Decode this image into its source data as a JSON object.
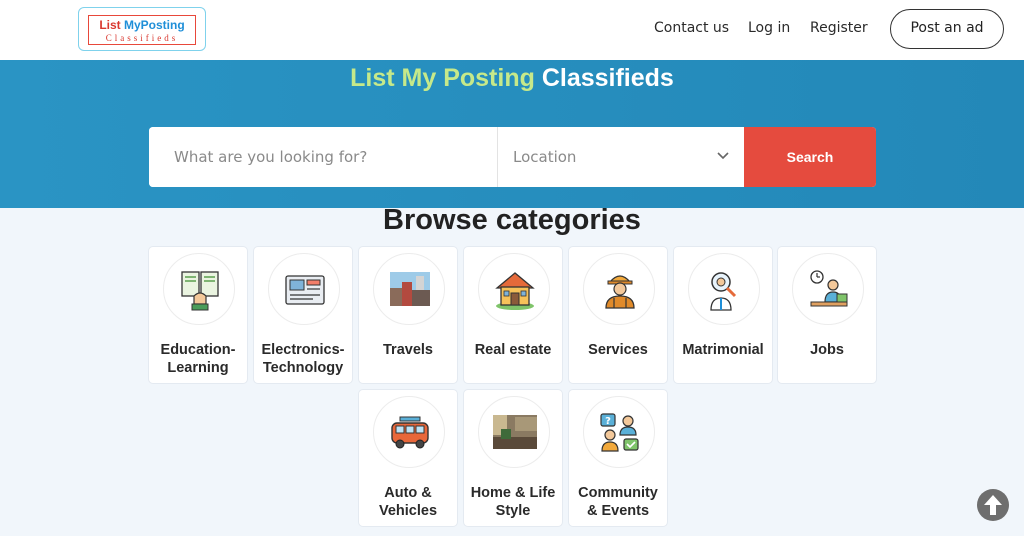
{
  "header": {
    "logo_line1_a": "List ",
    "logo_line1_b": "MyPosting",
    "logo_line2": "Classifieds",
    "nav": {
      "contact": "Contact us",
      "login": "Log in",
      "register": "Register"
    },
    "post_ad": "Post an ad"
  },
  "hero": {
    "title_a": "List My Posting",
    "title_b": "Classifieds",
    "search_placeholder": "What are you looking for?",
    "location_placeholder": "Location",
    "search_button": "Search"
  },
  "browse": {
    "title": "Browse categories",
    "categories": [
      {
        "label": "Education-\nLearning",
        "icon": "education-icon"
      },
      {
        "label": "Electronics-\nTechnology",
        "icon": "electronics-icon"
      },
      {
        "label": "Travels",
        "icon": "travels-icon"
      },
      {
        "label": "Real estate",
        "icon": "real-estate-icon"
      },
      {
        "label": "Services",
        "icon": "services-icon"
      },
      {
        "label": "Matrimonial",
        "icon": "matrimonial-icon"
      },
      {
        "label": "Jobs",
        "icon": "jobs-icon"
      },
      {
        "label": "Auto &\nVehicles",
        "icon": "auto-vehicles-icon"
      },
      {
        "label": "Home & Life\nStyle",
        "icon": "home-lifestyle-icon"
      },
      {
        "label": "Community\n& Events",
        "icon": "community-events-icon"
      }
    ]
  },
  "colors": {
    "hero_bg": "#2388b8",
    "accent_green": "#c6e98a",
    "search_red": "#e54b3e"
  }
}
